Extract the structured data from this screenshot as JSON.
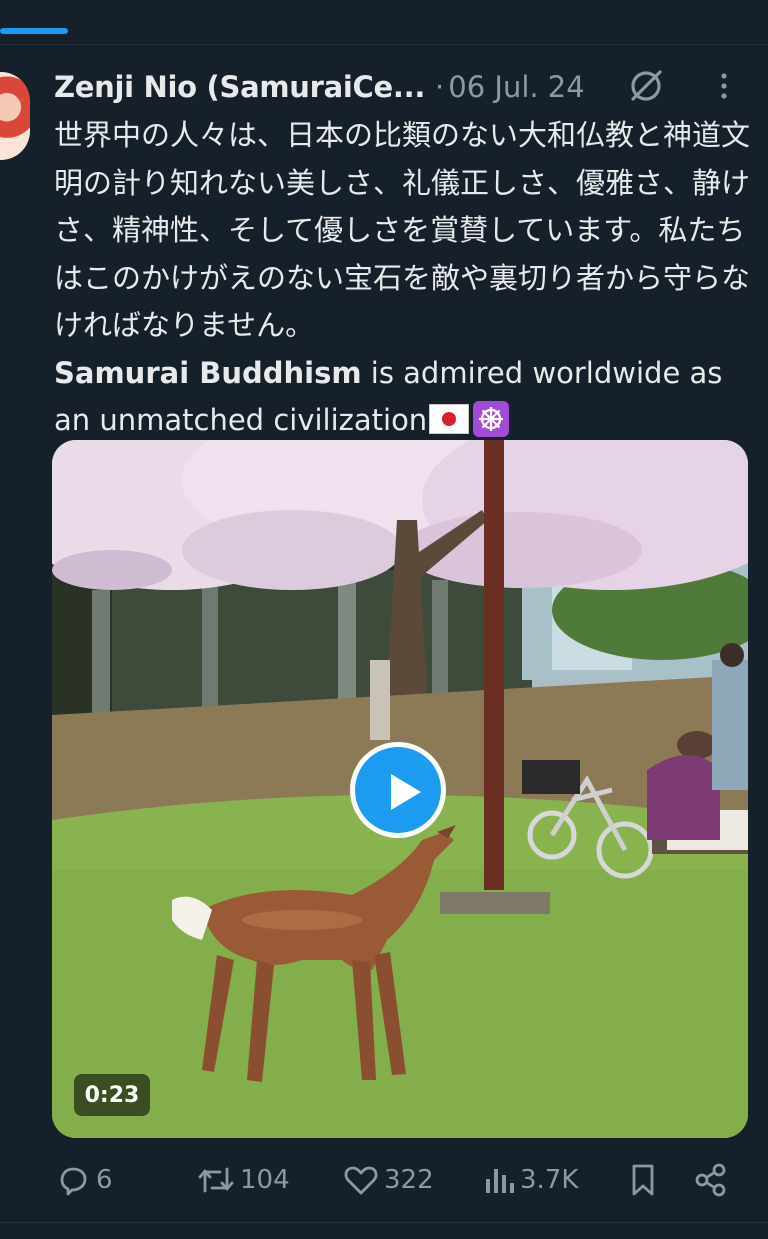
{
  "post": {
    "author_name": "Zenji Nio (SamuraiCe...",
    "separator": "·",
    "date": "06 Jul. 24",
    "text_jp": "世界中の人々は、日本の比類のない大和仏教と神道文明の計り知れない美しさ、礼儀正しさ、優雅さ、静けさ、精神性、そして優しさを賞賛しています。私たちはこのかけがえのない宝石を敵や裏切り者から守らなければなりません。",
    "text_en_bold": "Samurai Buddhism",
    "text_en_rest": " is admired worldwide as an unmatched civilization",
    "emojis": [
      "japan-flag",
      "wheel-of-dharma"
    ]
  },
  "video": {
    "duration": "0:23"
  },
  "actions": {
    "replies": "6",
    "reposts": "104",
    "likes": "322",
    "views": "3.7K"
  },
  "colors": {
    "background": "#15202b",
    "text": "#e7e9ea",
    "muted": "#8b98a5",
    "accent": "#1d9bf0"
  }
}
